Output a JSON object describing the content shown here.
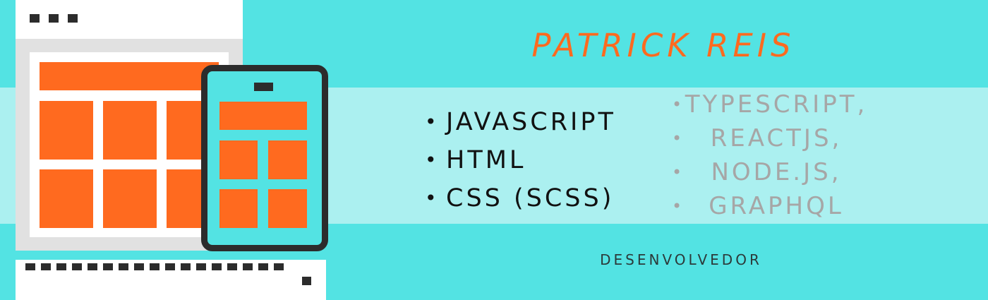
{
  "colors": {
    "background_cyan": "#53e3e3",
    "band_light_cyan": "#abf0f0",
    "accent_orange": "#ff6a1f",
    "dark_frame": "#2c2c2c",
    "muted_gray": "#a6a6a6"
  },
  "header": {
    "name": "PATRICK REIS"
  },
  "skills": {
    "primary": [
      "JAVASCRIPT",
      "HTML",
      "CSS (SCSS)"
    ],
    "secondary": [
      "TYPESCRIPT,",
      "REACTJS,",
      "NODE.JS,",
      "GRAPHQL"
    ]
  },
  "footer": {
    "role": "DESENVOLVEDOR"
  },
  "illustration": {
    "icons": [
      "browser-window-illustration",
      "tablet-device-illustration"
    ]
  }
}
